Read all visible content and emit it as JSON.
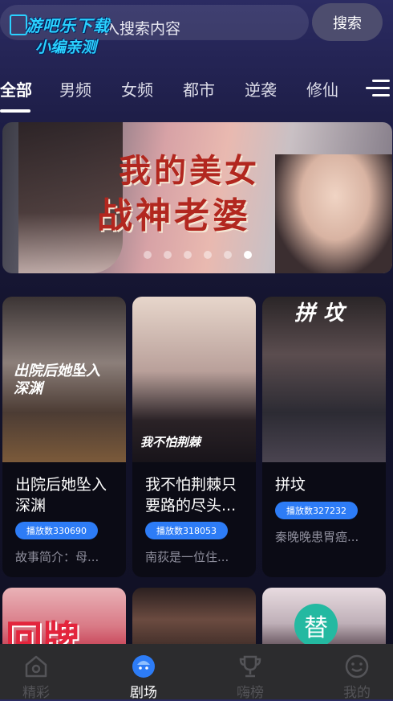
{
  "header": {
    "search_placeholder": "入搜索内容",
    "search_button": "搜索",
    "watermark_line1": "游吧乐下载",
    "watermark_line2": "小编亲测"
  },
  "tabs": [
    "全部",
    "男频",
    "女频",
    "都市",
    "逆袭",
    "修仙"
  ],
  "banner": {
    "title_line1": "我的美女",
    "title_line2": "战神老婆",
    "dot_count": 6,
    "active_dot": 6
  },
  "cards": [
    {
      "title": "出院后她坠入深渊",
      "badge": "播放数330690",
      "desc": "故事简介：母...",
      "cover_text": "出院后她坠入深渊"
    },
    {
      "title": "我不怕荆棘只要路的尽头...",
      "badge": "播放数318053",
      "desc": "南荻是一位住...",
      "cover_text": "我不怕荆棘"
    },
    {
      "title": "拼坟",
      "badge": "播放数327232",
      "desc": "秦晚晚患胃癌...",
      "cover_text": "拼坟"
    }
  ],
  "partial_covers": {
    "p1_text": "回牌",
    "p3_badge": "替"
  },
  "bottom_nav": [
    {
      "label": "精彩",
      "icon": "home-icon"
    },
    {
      "label": "剧场",
      "icon": "theater-icon"
    },
    {
      "label": "嗨榜",
      "icon": "trophy-icon"
    },
    {
      "label": "我的",
      "icon": "smile-icon"
    }
  ],
  "colors": {
    "accent_blue": "#2d7cf6",
    "nav_bg": "#2c2c2e",
    "card_bg": "#0b0b15"
  }
}
